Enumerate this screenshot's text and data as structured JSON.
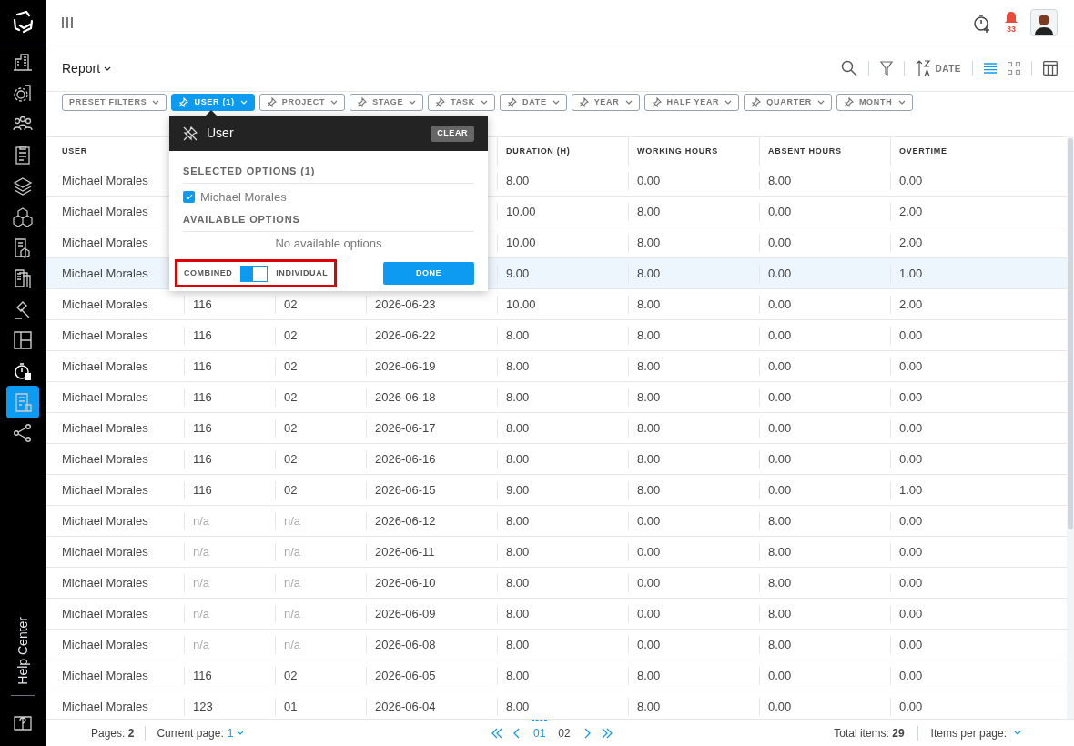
{
  "sidebar": {
    "items": [
      {
        "selected": false
      },
      {
        "selected": false
      },
      {
        "selected": false
      },
      {
        "selected": false
      },
      {
        "selected": false
      },
      {
        "selected": false
      },
      {
        "selected": false
      },
      {
        "selected": false
      },
      {
        "selected": false
      },
      {
        "selected": false
      },
      {
        "selected": false
      },
      {
        "selected": true
      },
      {
        "selected": false
      },
      {
        "selected": false
      }
    ],
    "help_label": "Help Center"
  },
  "topbar": {
    "notifications": "33"
  },
  "toolbar": {
    "title": "Report",
    "sort_label": "DATE",
    "list_view_selected": true
  },
  "filters": [
    {
      "label": "PRESET FILTERS",
      "pinned": false,
      "active": false
    },
    {
      "label": "USER (1)",
      "pinned": true,
      "active": true
    },
    {
      "label": "PROJECT",
      "pinned": true,
      "active": false
    },
    {
      "label": "STAGE",
      "pinned": true,
      "active": false
    },
    {
      "label": "TASK",
      "pinned": true,
      "active": false
    },
    {
      "label": "DATE",
      "pinned": true,
      "active": false
    },
    {
      "label": "YEAR",
      "pinned": true,
      "active": false
    },
    {
      "label": "HALF YEAR",
      "pinned": true,
      "active": false
    },
    {
      "label": "QUARTER",
      "pinned": true,
      "active": false
    },
    {
      "label": "MONTH",
      "pinned": true,
      "active": false
    }
  ],
  "popup": {
    "title": "User",
    "clear": "CLEAR",
    "selected_heading": "SELECTED OPTIONS (1)",
    "selected_options": [
      {
        "label": "Michael Morales",
        "checked": true
      }
    ],
    "available_heading": "AVAILABLE OPTIONS",
    "empty_text": "No available options",
    "toggle": {
      "left": "COMBINED",
      "right": "INDIVIDUAL",
      "on": true,
      "highlighted": true
    },
    "done": "DONE"
  },
  "table": {
    "columns": [
      "USER",
      "DURATION (H)",
      "WORKING HOURS",
      "ABSENT HOURS",
      "OVERTIME"
    ],
    "rows": [
      {
        "cells": [
          "Michael Morales",
          "8.00",
          "0.00",
          "8.00",
          "0.00"
        ],
        "highlighted": false
      },
      {
        "cells": [
          "Michael Morales",
          "10.00",
          "8.00",
          "0.00",
          "2.00"
        ],
        "highlighted": false
      },
      {
        "cells": [
          "Michael Morales",
          "10.00",
          "8.00",
          "0.00",
          "2.00"
        ],
        "highlighted": false
      },
      {
        "cells": [
          "Michael Morales",
          "9.00",
          "8.00",
          "0.00",
          "1.00"
        ],
        "highlighted": true
      },
      {
        "cells": [
          "Michael Morales",
          "116",
          "02",
          "2026-06-23",
          "10.00",
          "8.00",
          "0.00",
          "2.00"
        ],
        "highlighted": false,
        "unassigned": false
      },
      {
        "cells": [
          "Michael Morales",
          "116",
          "02",
          "2026-06-22",
          "8.00",
          "8.00",
          "0.00",
          "0.00"
        ],
        "highlighted": false,
        "unassigned": false
      },
      {
        "cells": [
          "Michael Morales",
          "116",
          "02",
          "2026-06-19",
          "8.00",
          "8.00",
          "0.00",
          "0.00"
        ],
        "highlighted": false,
        "unassigned": false
      },
      {
        "cells": [
          "Michael Morales",
          "116",
          "02",
          "2026-06-18",
          "8.00",
          "8.00",
          "0.00",
          "0.00"
        ],
        "highlighted": false,
        "unassigned": false
      },
      {
        "cells": [
          "Michael Morales",
          "116",
          "02",
          "2026-06-17",
          "8.00",
          "8.00",
          "0.00",
          "0.00"
        ],
        "highlighted": false,
        "unassigned": false
      },
      {
        "cells": [
          "Michael Morales",
          "116",
          "02",
          "2026-06-16",
          "8.00",
          "8.00",
          "0.00",
          "0.00"
        ],
        "highlighted": false,
        "unassigned": false
      },
      {
        "cells": [
          "Michael Morales",
          "116",
          "02",
          "2026-06-15",
          "9.00",
          "8.00",
          "0.00",
          "1.00"
        ],
        "highlighted": false,
        "unassigned": false
      },
      {
        "cells": [
          "Michael Morales",
          "n/a",
          "n/a",
          "2026-06-12",
          "8.00",
          "0.00",
          "8.00",
          "0.00"
        ],
        "highlighted": false,
        "unassigned": true
      },
      {
        "cells": [
          "Michael Morales",
          "n/a",
          "n/a",
          "2026-06-11",
          "8.00",
          "0.00",
          "8.00",
          "0.00"
        ],
        "highlighted": false,
        "unassigned": true
      },
      {
        "cells": [
          "Michael Morales",
          "n/a",
          "n/a",
          "2026-06-10",
          "8.00",
          "0.00",
          "8.00",
          "0.00"
        ],
        "highlighted": false,
        "unassigned": true
      },
      {
        "cells": [
          "Michael Morales",
          "n/a",
          "n/a",
          "2026-06-09",
          "8.00",
          "0.00",
          "8.00",
          "0.00"
        ],
        "highlighted": false,
        "unassigned": true
      },
      {
        "cells": [
          "Michael Morales",
          "n/a",
          "n/a",
          "2026-06-08",
          "8.00",
          "0.00",
          "8.00",
          "0.00"
        ],
        "highlighted": false,
        "unassigned": true
      },
      {
        "cells": [
          "Michael Morales",
          "116",
          "02",
          "2026-06-05",
          "8.00",
          "8.00",
          "0.00",
          "0.00"
        ],
        "highlighted": false,
        "unassigned": false
      },
      {
        "cells": [
          "Michael Morales",
          "123",
          "01",
          "2026-06-04",
          "8.00",
          "8.00",
          "0.00",
          "0.00"
        ],
        "highlighted": false,
        "unassigned": false
      }
    ]
  },
  "footer": {
    "pages_label": "Pages:",
    "pages": "2",
    "current_label": "Current page:",
    "current": "1",
    "page_links": [
      {
        "label": "01",
        "selected": true
      },
      {
        "label": "02",
        "selected": false
      }
    ],
    "total_label": "Total items:",
    "total": "29",
    "per_page_label": "Items per page:"
  }
}
